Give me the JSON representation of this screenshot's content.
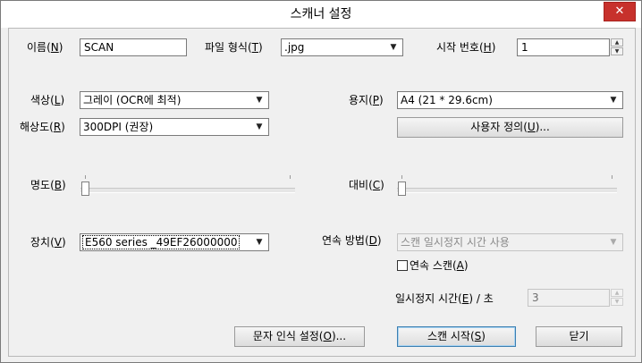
{
  "window": {
    "title": "스캐너 설정",
    "close_glyph": "✕"
  },
  "name": {
    "label_pre": "이름(",
    "key": "N",
    "label_post": ")",
    "value": "SCAN"
  },
  "file_format": {
    "label_pre": "파일 형식(",
    "key": "T",
    "label_post": ")",
    "value": ".jpg"
  },
  "start_number": {
    "label_pre": "시작 번호(",
    "key": "H",
    "label_post": ")",
    "value": "1"
  },
  "color": {
    "label_pre": "색상(",
    "key": "L",
    "label_post": ")",
    "value": "그레이 (OCR에 최적)"
  },
  "resolution": {
    "label_pre": "해상도(",
    "key": "R",
    "label_post": ")",
    "value": "300DPI (권장)"
  },
  "paper": {
    "label_pre": "용지(",
    "key": "P",
    "label_post": ")",
    "value": "A4 (21 * 29.6cm)"
  },
  "custom_button": {
    "label_pre": "사용자 정의(",
    "key": "U",
    "label_post": ")..."
  },
  "brightness": {
    "label_pre": "명도(",
    "key": "B",
    "label_post": ")",
    "level": 0
  },
  "contrast": {
    "label_pre": "대비(",
    "key": "C",
    "label_post": ")",
    "level": 0
  },
  "device": {
    "label_pre": "장치(",
    "key": "V",
    "label_post": ")",
    "value": "E560 series _49EF26000000"
  },
  "continuous_method": {
    "label_pre": "연속 방법(",
    "key": "D",
    "label_post": ")",
    "value": "스캔 일시정지 시간 사용"
  },
  "continuous_scan": {
    "label_pre": "연속 스캔(",
    "key": "A",
    "label_post": ")",
    "checked": false
  },
  "pause_time": {
    "label_pre": "일시정지 시간(",
    "key": "E",
    "label_post": ") / 초",
    "value": "3"
  },
  "buttons": {
    "ocr_pre": "문자 인식 설정(",
    "ocr_key": "O",
    "ocr_post": ")...",
    "start_pre": "스캔 시작(",
    "start_key": "S",
    "start_post": ")",
    "close": "닫기"
  },
  "icons": {
    "combo_arrow": "▼",
    "spin_up": "▲",
    "spin_down": "▼"
  }
}
